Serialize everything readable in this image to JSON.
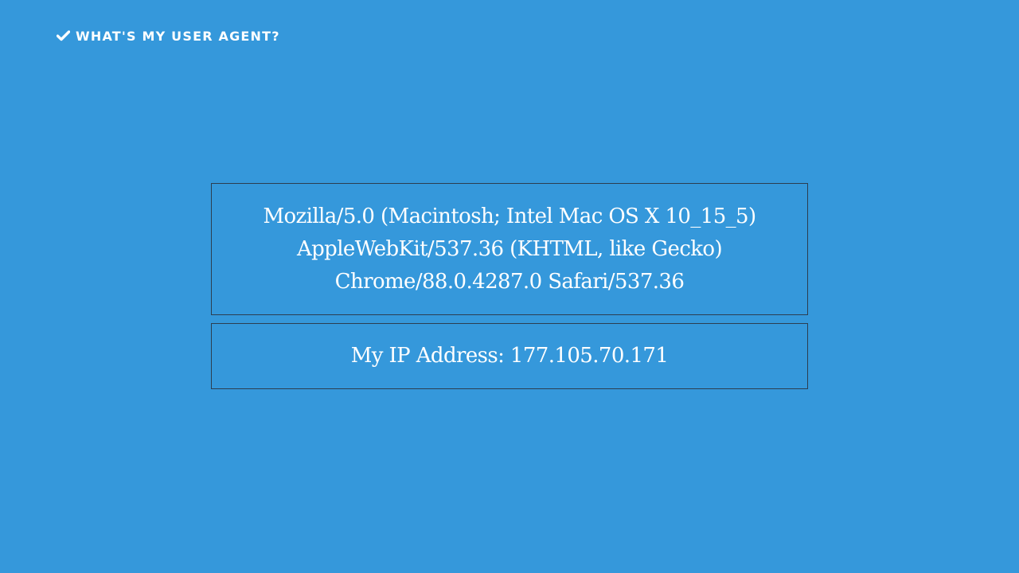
{
  "header": {
    "title": "WHAT'S MY USER AGENT?",
    "icon": "check-icon"
  },
  "user_agent": {
    "lines": [
      "Mozilla/5.0 (Macintosh; Intel Mac OS X 10_15_5)",
      "AppleWebKit/537.36 (KHTML, like Gecko)",
      "Chrome/88.0.4287.0 Safari/537.36"
    ]
  },
  "ip": {
    "text": "My IP Address: 177.105.70.171"
  },
  "colors": {
    "background": "#3598db",
    "border": "#2c3e50",
    "text": "#ffffff"
  }
}
